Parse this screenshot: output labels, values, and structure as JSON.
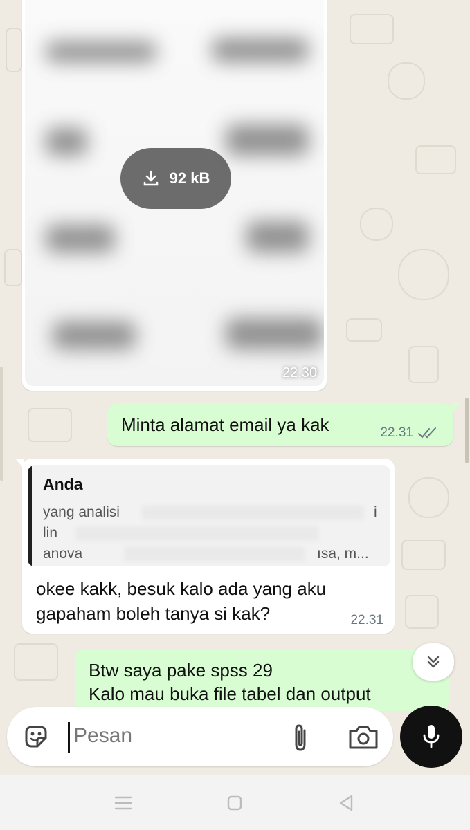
{
  "image_message": {
    "download_size": "92 kB",
    "time": "22.30"
  },
  "outgoing_1": {
    "text": "Minta alamat email ya kak",
    "time": "22.31",
    "status_icon": "double-check-icon"
  },
  "incoming_reply": {
    "quoted_sender": "Anda",
    "quoted_lines": [
      "yang analisi",
      "lin",
      "anova"
    ],
    "quoted_line_1_end": "i",
    "quoted_line_3_end": "ısa, m...",
    "text": "okee kakk, besuk kalo ada yang aku gapaham boleh tanya si kak?",
    "time": "22.31"
  },
  "outgoing_2": {
    "line1": "Btw saya pake spss 29",
    "line2": "Kalo mau buka file tabel dan output"
  },
  "input_bar": {
    "placeholder": "Pesan"
  },
  "colors": {
    "outgoing_bubble": "#d9fdd3",
    "incoming_bubble": "#ffffff",
    "wallpaper": "#efeae2",
    "mic_button": "#111111"
  }
}
